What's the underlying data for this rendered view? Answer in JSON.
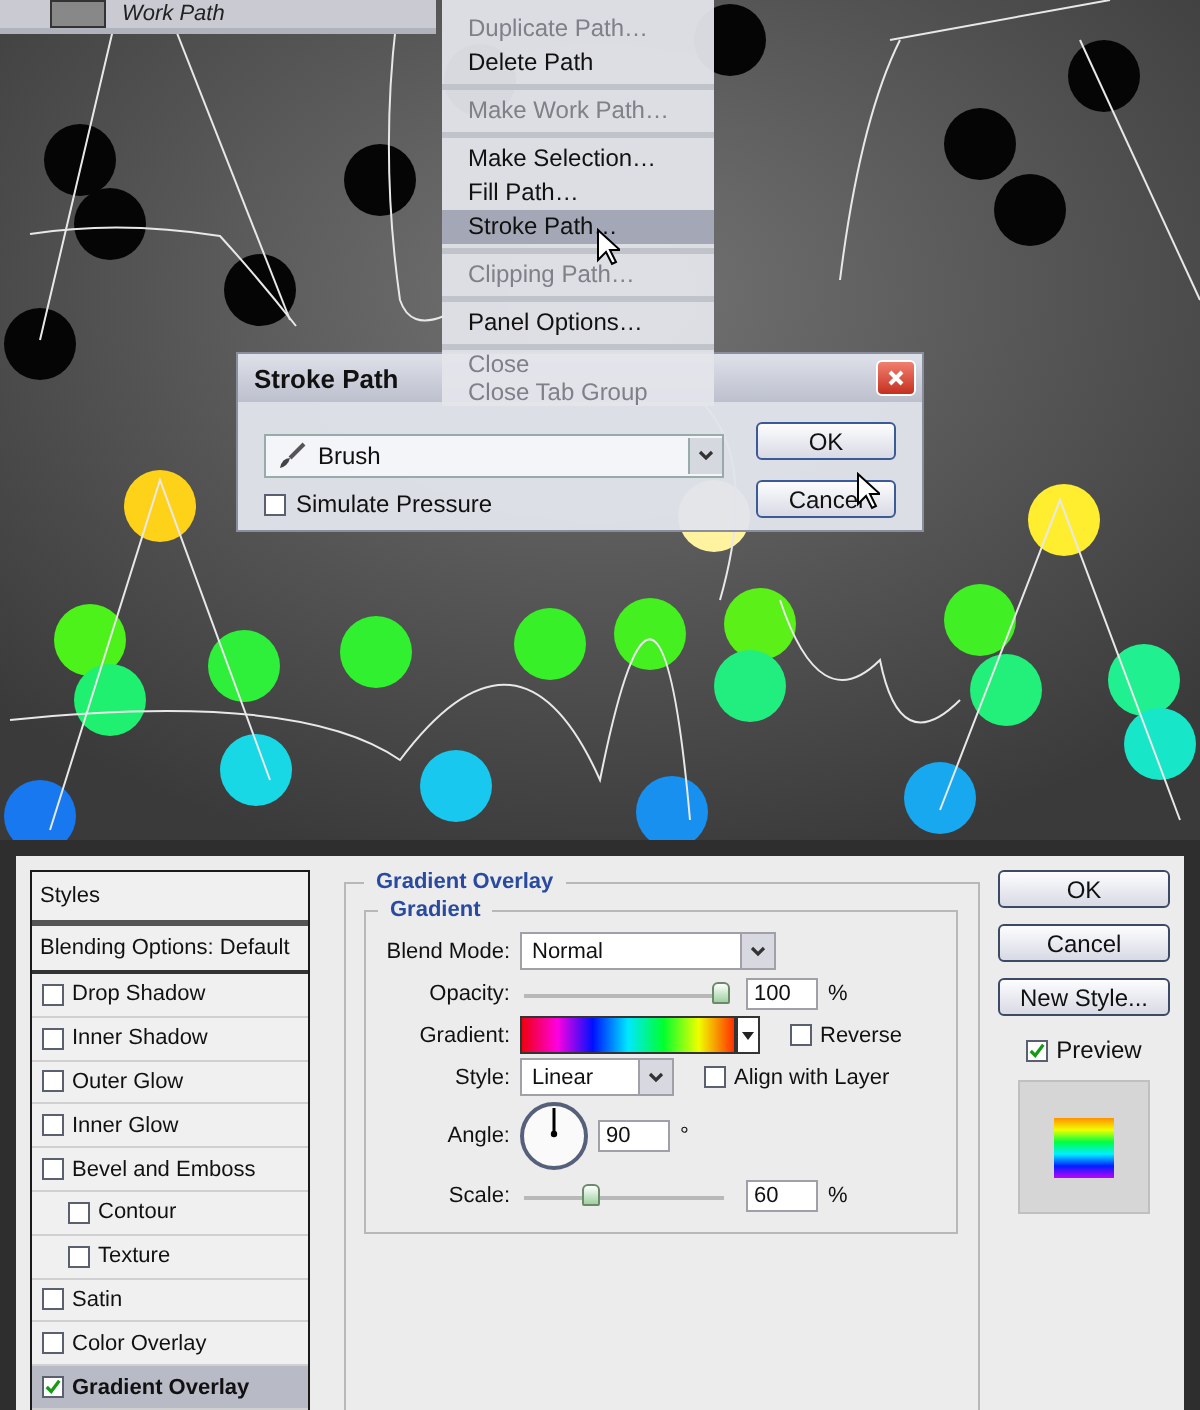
{
  "paths_panel": {
    "path_name": "Work Path"
  },
  "context_menu": {
    "groups": [
      [
        {
          "label": "Duplicate Path…",
          "disabled": true,
          "selected": false
        },
        {
          "label": "Delete Path",
          "disabled": false,
          "selected": false
        }
      ],
      [
        {
          "label": "Make Work Path…",
          "disabled": true,
          "selected": false
        }
      ],
      [
        {
          "label": "Make Selection…",
          "disabled": false,
          "selected": false
        },
        {
          "label": "Fill Path…",
          "disabled": false,
          "selected": false
        },
        {
          "label": "Stroke Path…",
          "disabled": false,
          "selected": true
        }
      ],
      [
        {
          "label": "Clipping Path…",
          "disabled": true,
          "selected": false
        }
      ],
      [
        {
          "label": "Panel Options…",
          "disabled": false,
          "selected": false
        }
      ],
      [
        {
          "label": "Close",
          "disabled": true,
          "selected": false
        },
        {
          "label": "Close Tab Group",
          "disabled": true,
          "selected": false
        }
      ]
    ]
  },
  "stroke_path_dialog": {
    "title": "Stroke Path",
    "tool": "Brush",
    "simulate_pressure": {
      "label": "Simulate Pressure",
      "checked": false
    },
    "buttons": [
      "OK",
      "Cancel"
    ]
  },
  "layer_style_dialog": {
    "styles_header": "Styles",
    "blending_options": "Blending Options: Default",
    "styles": [
      {
        "label": "Drop Shadow",
        "checked": false,
        "selected": false
      },
      {
        "label": "Inner Shadow",
        "checked": false,
        "selected": false
      },
      {
        "label": "Outer Glow",
        "checked": false,
        "selected": false
      },
      {
        "label": "Inner Glow",
        "checked": false,
        "selected": false
      },
      {
        "label": "Bevel and Emboss",
        "checked": false,
        "selected": false,
        "children": [
          {
            "label": "Contour",
            "checked": false,
            "selected": false
          },
          {
            "label": "Texture",
            "checked": false,
            "selected": false
          }
        ]
      },
      {
        "label": "Satin",
        "checked": false,
        "selected": false
      },
      {
        "label": "Color Overlay",
        "checked": false,
        "selected": false
      },
      {
        "label": "Gradient Overlay",
        "checked": true,
        "selected": true
      }
    ],
    "section_title": "Gradient Overlay",
    "group_title": "Gradient",
    "blend_mode": {
      "label": "Blend Mode:",
      "value": "Normal"
    },
    "opacity": {
      "label": "Opacity:",
      "level": 0.98,
      "value": "100",
      "unit": "%"
    },
    "gradient": {
      "label": "Gradient:"
    },
    "reverse": {
      "label": "Reverse",
      "checked": false
    },
    "style": {
      "label": "Style:",
      "value": "Linear"
    },
    "align_with_layer": {
      "label": "Align with Layer",
      "checked": false
    },
    "angle": {
      "label": "Angle:",
      "value": "90",
      "unit": "°"
    },
    "scale": {
      "label": "Scale:",
      "level": 0.33,
      "value": "60",
      "unit": "%"
    },
    "buttons": [
      "OK",
      "Cancel",
      "New Style..."
    ],
    "preview": {
      "label": "Preview",
      "checked": true
    }
  }
}
